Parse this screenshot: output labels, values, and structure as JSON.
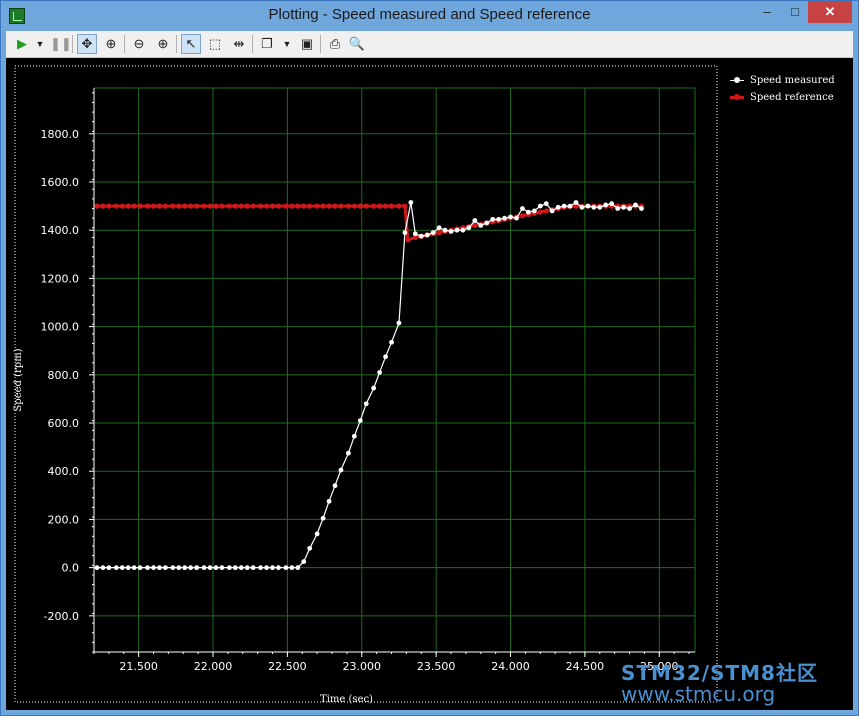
{
  "window": {
    "title": "Plotting  - Speed measured and Speed reference",
    "min_glyph": "–",
    "max_glyph": "□",
    "close_glyph": "✕"
  },
  "toolbar": {
    "icons": [
      "play-icon",
      "dropdown-arrow-icon",
      "pause-icon",
      "pan-icon",
      "zoom-window-icon",
      "zoom-out-icon",
      "zoom-in-icon",
      "select-pointer-icon",
      "rectangle-select-icon",
      "fit-icon",
      "copy-icon",
      "dropdown-arrow-icon",
      "save-icon",
      "print-icon",
      "print-preview-icon"
    ]
  },
  "legend": [
    {
      "label": "Speed measured",
      "color": "#ffffff"
    },
    {
      "label": "Speed reference",
      "color": "#d01818"
    }
  ],
  "watermark": {
    "line1": "STM32/STM8社区",
    "line2": "www.stmcu.org"
  },
  "chart_data": {
    "type": "line",
    "xlabel": "Time (sec)",
    "ylabel": "Speed (rpm)",
    "xlim": [
      21.2,
      25.24
    ],
    "ylim": [
      -350,
      1990
    ],
    "x_ticks": [
      21.5,
      22.0,
      22.5,
      23.0,
      23.5,
      24.0,
      24.5,
      25.0
    ],
    "x_tick_labels": [
      "21.500",
      "22.000",
      "22.500",
      "23.000",
      "23.500",
      "24.000",
      "24.500",
      "25.000"
    ],
    "y_ticks": [
      -200,
      0,
      200,
      400,
      600,
      800,
      1000,
      1200,
      1400,
      1600,
      1800
    ],
    "y_tick_labels": [
      "-200.0",
      "0.0",
      "200.0",
      "400.0",
      "600.0",
      "800.0",
      "1000.0",
      "1200.0",
      "1400.0",
      "1600.0",
      "1800.0"
    ],
    "grid": true,
    "background": "#000000",
    "grid_color": "#1f6b1f",
    "legend_position": "right",
    "series": [
      {
        "name": "Speed measured",
        "color": "#ffffff",
        "points": [
          [
            21.22,
            0
          ],
          [
            21.26,
            0
          ],
          [
            21.3,
            0
          ],
          [
            21.35,
            0
          ],
          [
            21.39,
            0
          ],
          [
            21.43,
            0
          ],
          [
            21.47,
            0
          ],
          [
            21.51,
            0
          ],
          [
            21.56,
            0
          ],
          [
            21.6,
            0
          ],
          [
            21.64,
            0
          ],
          [
            21.68,
            0
          ],
          [
            21.73,
            0
          ],
          [
            21.77,
            0
          ],
          [
            21.81,
            0
          ],
          [
            21.85,
            0
          ],
          [
            21.89,
            0
          ],
          [
            21.94,
            0
          ],
          [
            21.98,
            0
          ],
          [
            22.02,
            0
          ],
          [
            22.06,
            0
          ],
          [
            22.11,
            0
          ],
          [
            22.15,
            0
          ],
          [
            22.19,
            0
          ],
          [
            22.23,
            0
          ],
          [
            22.27,
            0
          ],
          [
            22.32,
            0
          ],
          [
            22.36,
            0
          ],
          [
            22.4,
            0
          ],
          [
            22.44,
            0
          ],
          [
            22.49,
            0
          ],
          [
            22.53,
            0
          ],
          [
            22.57,
            0
          ],
          [
            22.61,
            25
          ],
          [
            22.65,
            80
          ],
          [
            22.7,
            140
          ],
          [
            22.74,
            205
          ],
          [
            22.78,
            275
          ],
          [
            22.82,
            340
          ],
          [
            22.86,
            405
          ],
          [
            22.91,
            475
          ],
          [
            22.95,
            545
          ],
          [
            22.99,
            610
          ],
          [
            23.03,
            680
          ],
          [
            23.08,
            745
          ],
          [
            23.12,
            810
          ],
          [
            23.16,
            875
          ],
          [
            23.2,
            935
          ],
          [
            23.25,
            1015
          ],
          [
            23.29,
            1390
          ],
          [
            23.33,
            1515
          ],
          [
            23.36,
            1385
          ],
          [
            23.4,
            1375
          ],
          [
            23.44,
            1380
          ],
          [
            23.48,
            1390
          ],
          [
            23.52,
            1410
          ],
          [
            23.56,
            1400
          ],
          [
            23.6,
            1395
          ],
          [
            23.64,
            1400
          ],
          [
            23.68,
            1400
          ],
          [
            23.72,
            1410
          ],
          [
            23.76,
            1440
          ],
          [
            23.8,
            1420
          ],
          [
            23.84,
            1430
          ],
          [
            23.88,
            1445
          ],
          [
            23.92,
            1445
          ],
          [
            23.96,
            1450
          ],
          [
            24.0,
            1455
          ],
          [
            24.04,
            1450
          ],
          [
            24.08,
            1490
          ],
          [
            24.12,
            1475
          ],
          [
            24.16,
            1480
          ],
          [
            24.2,
            1500
          ],
          [
            24.24,
            1510
          ],
          [
            24.28,
            1480
          ],
          [
            24.32,
            1495
          ],
          [
            24.36,
            1500
          ],
          [
            24.4,
            1500
          ],
          [
            24.44,
            1515
          ],
          [
            24.48,
            1495
          ],
          [
            24.52,
            1500
          ],
          [
            24.56,
            1495
          ],
          [
            24.6,
            1495
          ],
          [
            24.64,
            1505
          ],
          [
            24.68,
            1510
          ],
          [
            24.72,
            1490
          ],
          [
            24.76,
            1495
          ],
          [
            24.8,
            1490
          ],
          [
            24.84,
            1505
          ],
          [
            24.88,
            1490
          ]
        ]
      },
      {
        "name": "Speed reference",
        "color": "#d01818",
        "points": [
          [
            21.22,
            1500
          ],
          [
            21.26,
            1500
          ],
          [
            21.3,
            1500
          ],
          [
            21.35,
            1500
          ],
          [
            21.39,
            1500
          ],
          [
            21.43,
            1500
          ],
          [
            21.47,
            1500
          ],
          [
            21.51,
            1500
          ],
          [
            21.56,
            1500
          ],
          [
            21.6,
            1500
          ],
          [
            21.64,
            1500
          ],
          [
            21.68,
            1500
          ],
          [
            21.73,
            1500
          ],
          [
            21.77,
            1500
          ],
          [
            21.81,
            1500
          ],
          [
            21.85,
            1500
          ],
          [
            21.89,
            1500
          ],
          [
            21.94,
            1500
          ],
          [
            21.98,
            1500
          ],
          [
            22.02,
            1500
          ],
          [
            22.06,
            1500
          ],
          [
            22.11,
            1500
          ],
          [
            22.15,
            1500
          ],
          [
            22.19,
            1500
          ],
          [
            22.23,
            1500
          ],
          [
            22.27,
            1500
          ],
          [
            22.32,
            1500
          ],
          [
            22.36,
            1500
          ],
          [
            22.4,
            1500
          ],
          [
            22.44,
            1500
          ],
          [
            22.49,
            1500
          ],
          [
            22.53,
            1500
          ],
          [
            22.57,
            1500
          ],
          [
            22.61,
            1500
          ],
          [
            22.65,
            1500
          ],
          [
            22.7,
            1500
          ],
          [
            22.74,
            1500
          ],
          [
            22.78,
            1500
          ],
          [
            22.82,
            1500
          ],
          [
            22.86,
            1500
          ],
          [
            22.91,
            1500
          ],
          [
            22.95,
            1500
          ],
          [
            22.99,
            1500
          ],
          [
            23.03,
            1500
          ],
          [
            23.08,
            1500
          ],
          [
            23.12,
            1500
          ],
          [
            23.16,
            1500
          ],
          [
            23.2,
            1500
          ],
          [
            23.25,
            1500
          ],
          [
            23.29,
            1500
          ],
          [
            23.31,
            1360
          ],
          [
            23.36,
            1370
          ],
          [
            23.4,
            1375
          ],
          [
            23.44,
            1380
          ],
          [
            23.48,
            1385
          ],
          [
            23.52,
            1390
          ],
          [
            23.56,
            1395
          ],
          [
            23.6,
            1400
          ],
          [
            23.64,
            1405
          ],
          [
            23.68,
            1410
          ],
          [
            23.72,
            1415
          ],
          [
            23.76,
            1420
          ],
          [
            23.8,
            1425
          ],
          [
            23.84,
            1430
          ],
          [
            23.88,
            1435
          ],
          [
            23.92,
            1440
          ],
          [
            23.96,
            1445
          ],
          [
            24.0,
            1450
          ],
          [
            24.04,
            1455
          ],
          [
            24.08,
            1460
          ],
          [
            24.12,
            1465
          ],
          [
            24.16,
            1470
          ],
          [
            24.2,
            1475
          ],
          [
            24.24,
            1480
          ],
          [
            24.28,
            1485
          ],
          [
            24.32,
            1490
          ],
          [
            24.36,
            1495
          ],
          [
            24.4,
            1498
          ],
          [
            24.44,
            1500
          ],
          [
            24.48,
            1500
          ],
          [
            24.52,
            1500
          ],
          [
            24.56,
            1500
          ],
          [
            24.6,
            1500
          ],
          [
            24.64,
            1500
          ],
          [
            24.68,
            1500
          ],
          [
            24.72,
            1500
          ],
          [
            24.76,
            1500
          ],
          [
            24.8,
            1500
          ],
          [
            24.84,
            1500
          ],
          [
            24.88,
            1500
          ]
        ]
      }
    ]
  }
}
